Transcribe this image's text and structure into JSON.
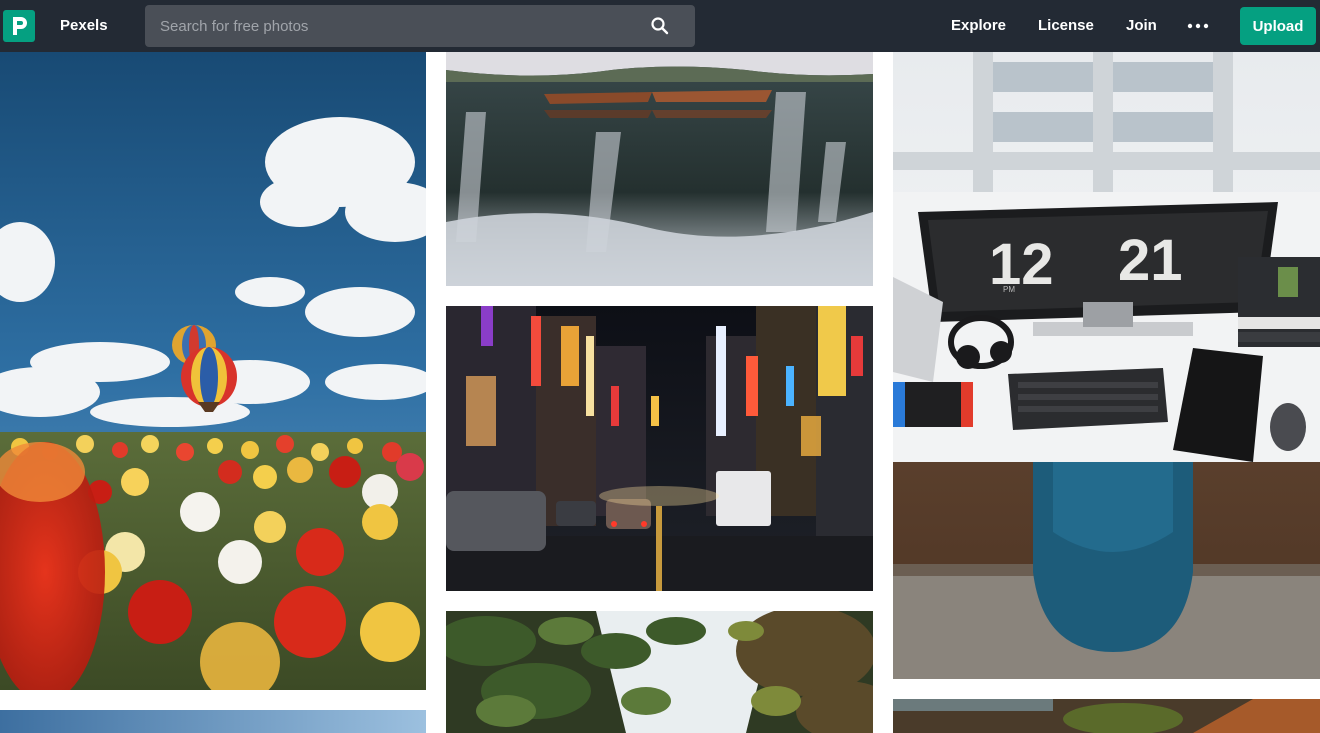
{
  "header": {
    "brand": "Pexels",
    "logo_icon": "pexels-logo-icon",
    "search": {
      "placeholder": "Search for free photos",
      "value": "",
      "icon": "search-icon"
    },
    "nav": {
      "explore": "Explore",
      "license": "License",
      "join": "Join",
      "more_icon": "more-dots-icon"
    },
    "upload_label": "Upload"
  },
  "colors": {
    "header_bg": "#232a34",
    "accent": "#05a081",
    "search_bg": "#4a4f57"
  },
  "photos": {
    "tulips": {
      "subject": "Tulip field with hot air balloons"
    },
    "lake_boats": {
      "subject": "Boats on a misty lake"
    },
    "city_night": {
      "subject": "City street at night with neon signs"
    },
    "desk_clock": {
      "clock_hours": "12",
      "clock_minutes": "21",
      "clock_pm": "PM"
    },
    "leaves": {
      "subject": "Green leaves canopy"
    },
    "sky_bottom": {
      "subject": "Blue sky"
    },
    "rooftop": {
      "subject": "Rooftop"
    }
  }
}
